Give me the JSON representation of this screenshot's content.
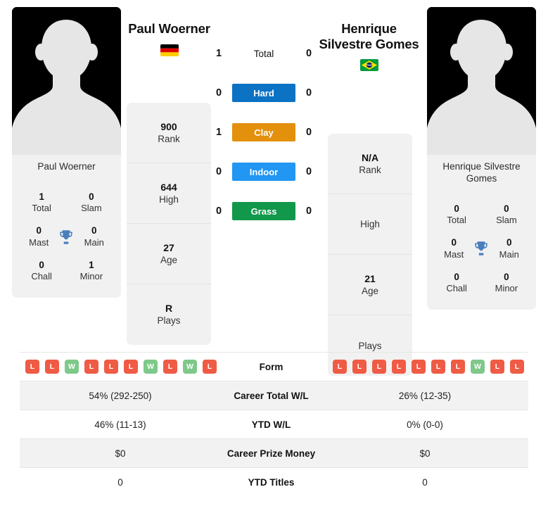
{
  "players": {
    "left": {
      "name": "Paul Woerner",
      "photo_caption": "Paul Woerner",
      "country": "Germany",
      "flag_icon": "flag-germany",
      "rank": "900",
      "rank_label": "Rank",
      "high": "644",
      "high_label": "High",
      "age": "27",
      "age_label": "Age",
      "plays": "R",
      "plays_label": "Plays",
      "titles": {
        "total": "1",
        "total_label": "Total",
        "slam": "0",
        "slam_label": "Slam",
        "mast": "0",
        "mast_label": "Mast",
        "main": "0",
        "main_label": "Main",
        "chall": "0",
        "chall_label": "Chall",
        "minor": "1",
        "minor_label": "Minor"
      },
      "form": [
        "L",
        "L",
        "W",
        "L",
        "L",
        "L",
        "W",
        "L",
        "W",
        "L"
      ],
      "career_wl": "54% (292-250)",
      "ytd_wl": "46% (11-13)",
      "prize_money": "$0",
      "ytd_titles": "0"
    },
    "right": {
      "name": "Henrique Silvestre Gomes",
      "photo_caption": "Henrique Silvestre Gomes",
      "country": "Brazil",
      "flag_icon": "flag-brazil",
      "rank": "N/A",
      "rank_label": "Rank",
      "high": "",
      "high_label": "High",
      "age": "21",
      "age_label": "Age",
      "plays": "",
      "plays_label": "Plays",
      "titles": {
        "total": "0",
        "total_label": "Total",
        "slam": "0",
        "slam_label": "Slam",
        "mast": "0",
        "mast_label": "Mast",
        "main": "0",
        "main_label": "Main",
        "chall": "0",
        "chall_label": "Chall",
        "minor": "0",
        "minor_label": "Minor"
      },
      "form": [
        "L",
        "L",
        "L",
        "L",
        "L",
        "L",
        "L",
        "W",
        "L",
        "L"
      ],
      "career_wl": "26% (12-35)",
      "ytd_wl": "0% (0-0)",
      "prize_money": "$0",
      "ytd_titles": "0"
    }
  },
  "h2h": {
    "rows": [
      {
        "label": "Total",
        "left": "1",
        "right": "0",
        "color": "",
        "style": "plain"
      },
      {
        "label": "Hard",
        "left": "0",
        "right": "0",
        "color": "#0b72c4",
        "style": "bar"
      },
      {
        "label": "Clay",
        "left": "1",
        "right": "0",
        "color": "#e3900d",
        "style": "bar"
      },
      {
        "label": "Indoor",
        "left": "0",
        "right": "0",
        "color": "#2196f3",
        "style": "bar"
      },
      {
        "label": "Grass",
        "left": "0",
        "right": "0",
        "color": "#11984b",
        "style": "bar"
      }
    ]
  },
  "table": {
    "rows": [
      {
        "label": "Form",
        "type": "form"
      },
      {
        "label": "Career Total W/L",
        "type": "text",
        "key": "career_wl"
      },
      {
        "label": "YTD W/L",
        "type": "text",
        "key": "ytd_wl"
      },
      {
        "label": "Career Prize Money",
        "type": "text",
        "key": "prize_money"
      },
      {
        "label": "YTD Titles",
        "type": "text",
        "key": "ytd_titles"
      }
    ]
  },
  "icons": {
    "trophy": "trophy-icon",
    "avatar": "avatar-silhouette-icon"
  },
  "colors": {
    "hard": "#0b72c4",
    "clay": "#e3900d",
    "indoor": "#2196f3",
    "grass": "#11984b",
    "win": "#7ec98a",
    "loss": "#ef5b45",
    "trophy": "#4a7ebb"
  }
}
